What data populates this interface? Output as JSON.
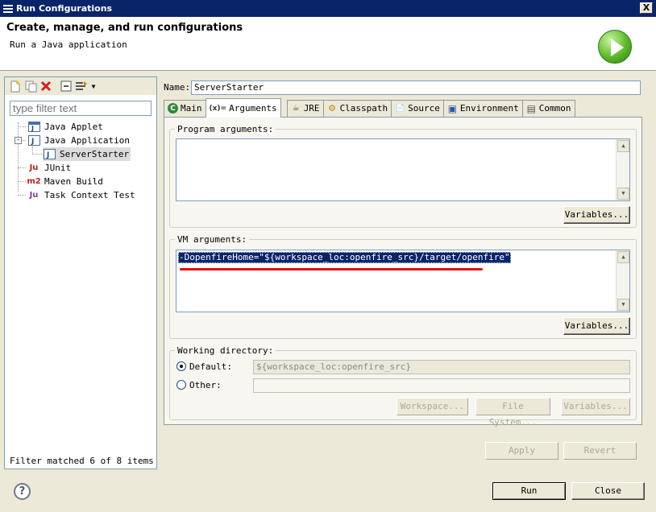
{
  "window": {
    "title": "Run Configurations",
    "close_glyph": "X"
  },
  "banner": {
    "heading": "Create, manage, and run configurations",
    "subtitle": "Run a Java application"
  },
  "left": {
    "filter_placeholder": "type filter text",
    "tree": [
      {
        "label": "Java Applet",
        "icon": "java-applet-icon"
      },
      {
        "label": "Java Application",
        "icon": "java-application-icon",
        "expanded": true
      },
      {
        "label": "ServerStarter",
        "icon": "java-class-icon",
        "selected": true
      },
      {
        "label": "JUnit",
        "icon": "junit-icon",
        "glyph": "Ju"
      },
      {
        "label": "Maven Build",
        "icon": "maven-icon",
        "glyph": "m2"
      },
      {
        "label": "Task Context Test",
        "icon": "task-context-icon",
        "glyph": "Ju"
      }
    ],
    "expander_glyph": "-",
    "status": "Filter matched 6 of 8 items"
  },
  "config": {
    "name_label": "Name:",
    "name_value": "ServerStarter",
    "tabs": [
      {
        "label": "Main",
        "icon": "main-tab-icon",
        "glyph": "C"
      },
      {
        "label": "Arguments",
        "icon": "arguments-tab-icon",
        "glyph": "(x)=",
        "active": true
      },
      {
        "label": "JRE",
        "icon": "jre-tab-icon",
        "glyph": "☕"
      },
      {
        "label": "Classpath",
        "icon": "classpath-tab-icon",
        "glyph": "⚙"
      },
      {
        "label": "Source",
        "icon": "source-tab-icon",
        "glyph": "📄"
      },
      {
        "label": "Environment",
        "icon": "environment-tab-icon",
        "glyph": "▣"
      },
      {
        "label": "Common",
        "icon": "common-tab-icon",
        "glyph": "▤"
      }
    ],
    "program_args": {
      "label": "Program arguments:",
      "value": "",
      "variables_button": "Variables..."
    },
    "vm_args": {
      "label": "VM arguments:",
      "value": "-DopenfireHome=\"${workspace_loc:openfire_src}/target/openfire\"",
      "variables_button": "Variables..."
    },
    "working_dir": {
      "label": "Working directory:",
      "default_label": "Default:",
      "default_value": "${workspace_loc:openfire_src}",
      "other_label": "Other:",
      "other_value": "",
      "selected": "default",
      "workspace_button": "Workspace...",
      "filesystem_button": "File System...",
      "variables_button": "Variables..."
    },
    "apply_button": "Apply",
    "revert_button": "Revert"
  },
  "footer": {
    "help_glyph": "?",
    "run_button": "Run",
    "close_button": "Close"
  },
  "colors": {
    "titlebar": "#0a246a",
    "selection": "#0a246a",
    "annotation": "#e01010",
    "run_icon": "#5cb82a"
  }
}
